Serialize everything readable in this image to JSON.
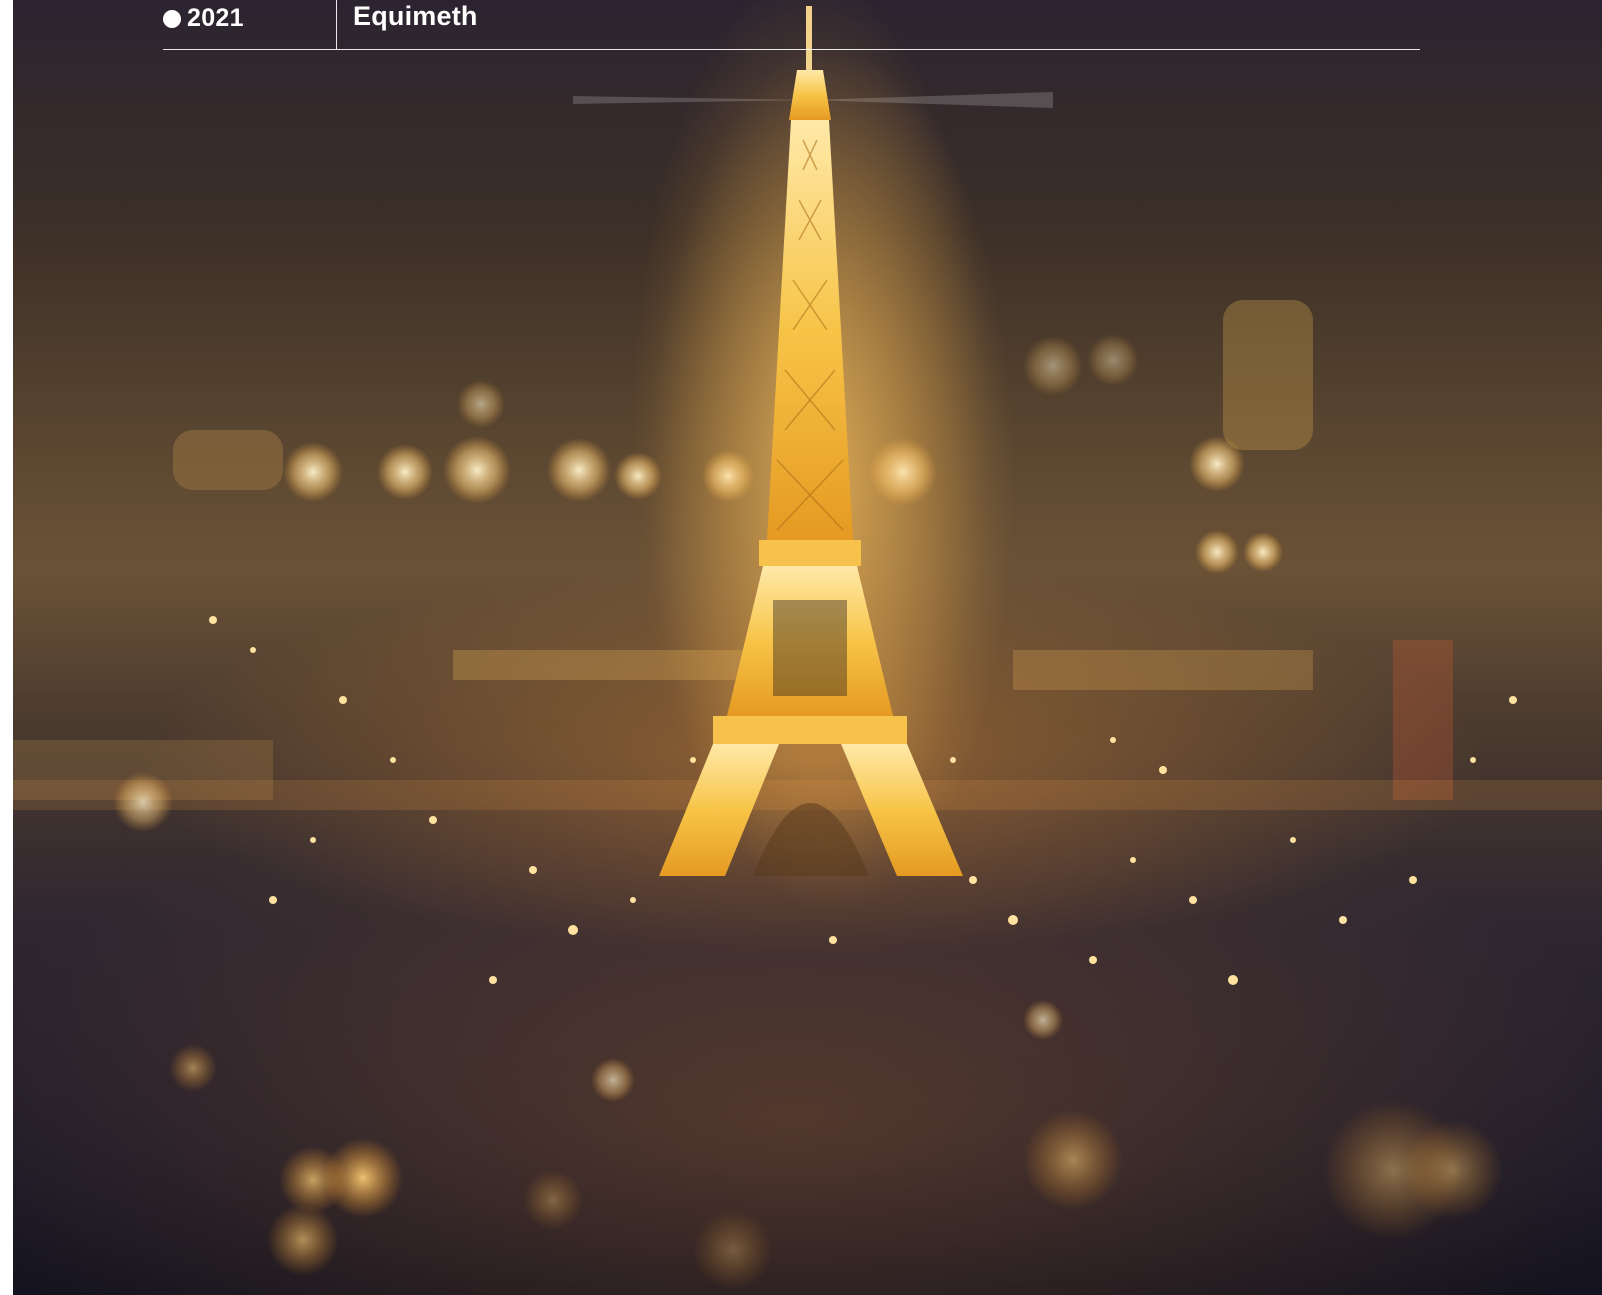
{
  "header": {
    "year": "2021",
    "brand": "Equimeth"
  },
  "cover_image": {
    "icon": "eiffel-tower-night-photo"
  },
  "colors": {
    "header_text": "#ffffff",
    "header_rule": "#ffffff",
    "tower_glow": "#f2b53c",
    "sky_dark": "#2b2430"
  }
}
